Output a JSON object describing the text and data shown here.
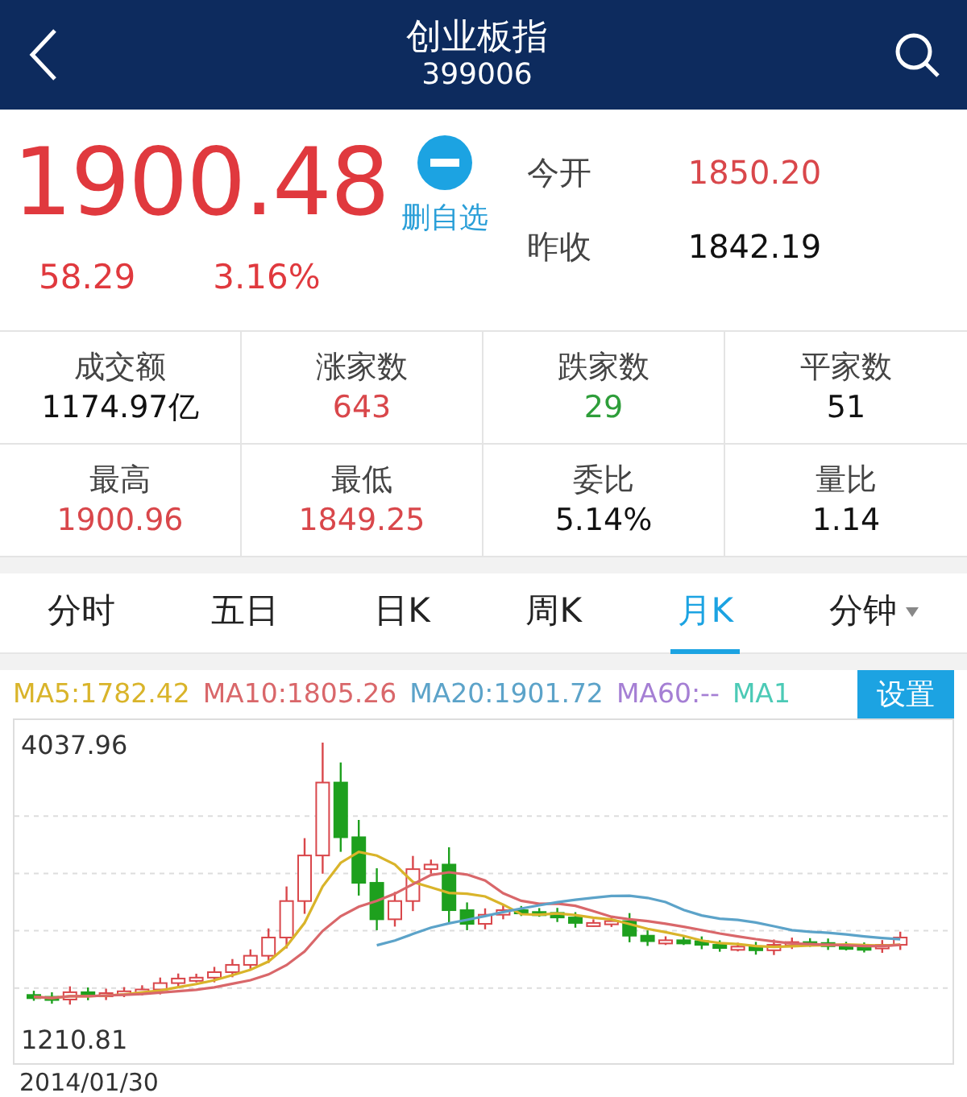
{
  "header": {
    "title": "创业板指",
    "code": "399006"
  },
  "quote": {
    "price": "1900.48",
    "change": "58.29",
    "change_pct": "3.16%",
    "watch_action": "删自选",
    "color": "#e0393e"
  },
  "summary": [
    {
      "label": "今开",
      "value": "1850.20",
      "color": "#d9474b"
    },
    {
      "label": "昨收",
      "value": "1842.19",
      "color": "#111111"
    }
  ],
  "stats": [
    {
      "label": "成交额",
      "value": "1174.97亿",
      "color": "#111111"
    },
    {
      "label": "涨家数",
      "value": "643",
      "color": "#d9474b"
    },
    {
      "label": "跌家数",
      "value": "29",
      "color": "#2e9e3a"
    },
    {
      "label": "平家数",
      "value": "51",
      "color": "#111111"
    },
    {
      "label": "最高",
      "value": "1900.96",
      "color": "#d9474b"
    },
    {
      "label": "最低",
      "value": "1849.25",
      "color": "#d9474b"
    },
    {
      "label": "委比",
      "value": "5.14%",
      "color": "#111111"
    },
    {
      "label": "量比",
      "value": "1.14",
      "color": "#111111"
    }
  ],
  "tabs": [
    {
      "label": "分时",
      "selected": false,
      "has_menu": false
    },
    {
      "label": "五日",
      "selected": false,
      "has_menu": false
    },
    {
      "label": "日K",
      "selected": false,
      "has_menu": false
    },
    {
      "label": "周K",
      "selected": false,
      "has_menu": false
    },
    {
      "label": "月K",
      "selected": true,
      "has_menu": false
    },
    {
      "label": "分钟",
      "selected": false,
      "has_menu": true
    }
  ],
  "chart": {
    "moving_averages": [
      {
        "text": "MA5:1782.42",
        "color": "#d9b42a"
      },
      {
        "text": "MA10:1805.26",
        "color": "#d9676a"
      },
      {
        "text": "MA20:1901.72",
        "color": "#5ca3c9"
      },
      {
        "text": "MA60:--",
        "color": "#a57fd4"
      },
      {
        "text": "MA1",
        "color": "#4ccab6"
      }
    ],
    "settings_button": "设置",
    "y_max_label": "4037.96",
    "y_min_label": "1210.81",
    "x_start_label": "2014/01/30"
  }
}
